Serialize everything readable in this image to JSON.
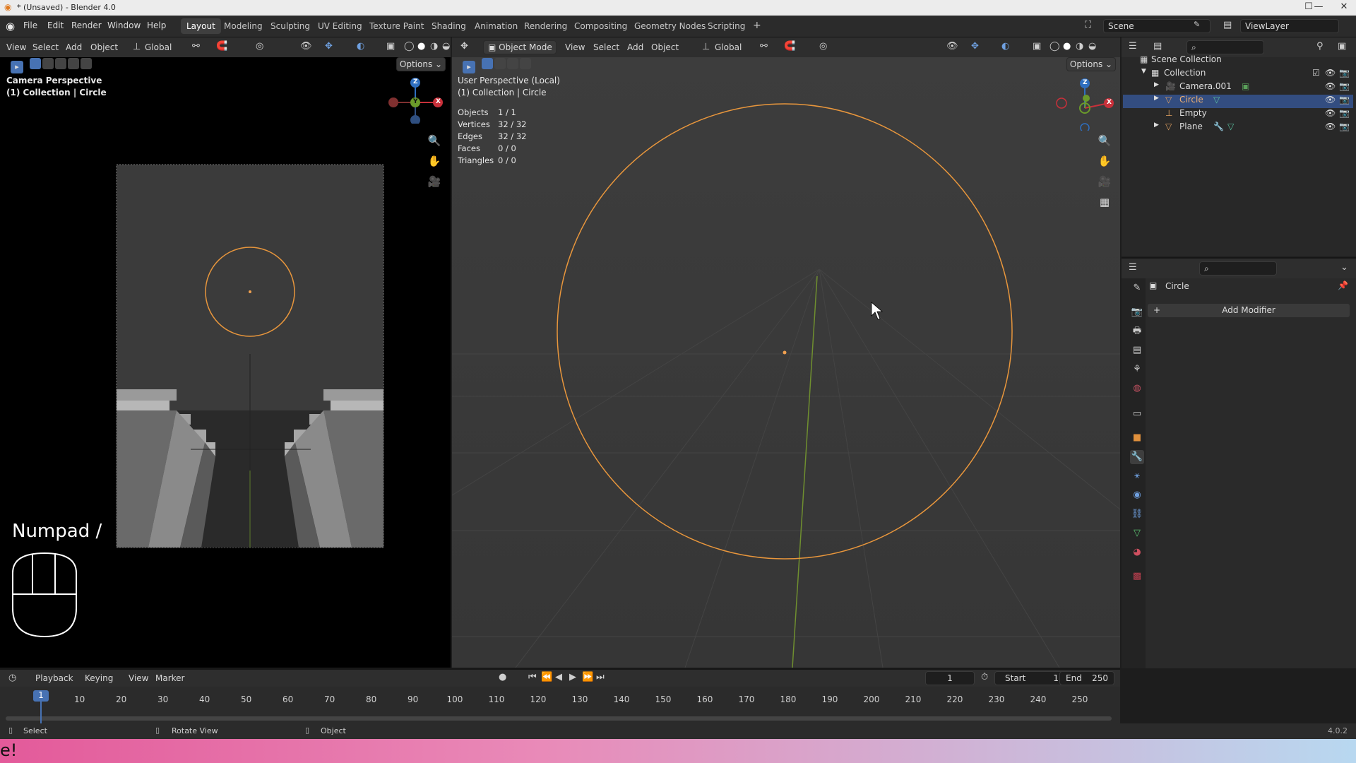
{
  "window": {
    "title": "* (Unsaved) - Blender 4.0",
    "minimize": "—",
    "maximize": "☐",
    "close": "✕"
  },
  "topbar": {
    "menus": [
      "File",
      "Edit",
      "Render",
      "Window",
      "Help"
    ],
    "workspaces": [
      "Layout",
      "Modeling",
      "Sculpting",
      "UV Editing",
      "Texture Paint",
      "Shading",
      "Animation",
      "Rendering",
      "Compositing",
      "Geometry Nodes",
      "Scripting"
    ],
    "active_workspace": "Layout",
    "add_workspace": "+",
    "scene": "Scene",
    "view_layer": "ViewLayer"
  },
  "left_viewport": {
    "header": {
      "menus": [
        "View",
        "Select",
        "Add",
        "Object"
      ],
      "orientation": "Global",
      "options": "Options"
    },
    "overlay_title": "Camera Perspective",
    "overlay_sub": "(1) Collection | Circle",
    "key_hint": "Numpad /",
    "gizmo": {
      "z": "Z",
      "y": "Y",
      "x": "X"
    }
  },
  "main_viewport": {
    "header": {
      "mode": "Object Mode",
      "menus": [
        "View",
        "Select",
        "Add",
        "Object"
      ],
      "orientation": "Global",
      "options": "Options"
    },
    "overlay_title": "User Perspective (Local)",
    "overlay_sub": "(1) Collection | Circle",
    "stats": [
      {
        "label": "Objects",
        "value": "1 / 1"
      },
      {
        "label": "Vertices",
        "value": "32 / 32"
      },
      {
        "label": "Edges",
        "value": "32 / 32"
      },
      {
        "label": "Faces",
        "value": "0 / 0"
      },
      {
        "label": "Triangles",
        "value": "0 / 0"
      }
    ],
    "gizmo": {
      "z": "Z",
      "x": "X"
    }
  },
  "outliner": {
    "root": "Scene Collection",
    "collection": "Collection",
    "items": [
      {
        "name": "Camera.001",
        "selected": false
      },
      {
        "name": "Circle",
        "selected": true
      },
      {
        "name": "Empty",
        "selected": false
      },
      {
        "name": "Plane",
        "selected": false
      }
    ]
  },
  "properties": {
    "object_name": "Circle",
    "add_modifier": "Add Modifier",
    "add_modifier_icon": "+"
  },
  "timeline": {
    "menus": [
      "Playback",
      "Keying",
      "View",
      "Marker"
    ],
    "current_frame": "1",
    "start_label": "Start",
    "start": "1",
    "end_label": "End",
    "end": "250",
    "ticks": [
      "10",
      "20",
      "30",
      "40",
      "50",
      "60",
      "70",
      "80",
      "90",
      "100",
      "110",
      "120",
      "130",
      "140",
      "150",
      "160",
      "170",
      "180",
      "190",
      "200",
      "210",
      "220",
      "230",
      "240",
      "250"
    ],
    "playhead": "1"
  },
  "statusbar": {
    "select": "Select",
    "rotate": "Rotate View",
    "object": "Object",
    "version": "4.0.2"
  },
  "bottom_banner": {
    "text": "e!"
  },
  "colors": {
    "accent": "#4772b3",
    "selection": "#f0a050",
    "x_axis": "#c9303a",
    "y_axis": "#6a9a2a",
    "z_axis": "#2f6fc0"
  }
}
